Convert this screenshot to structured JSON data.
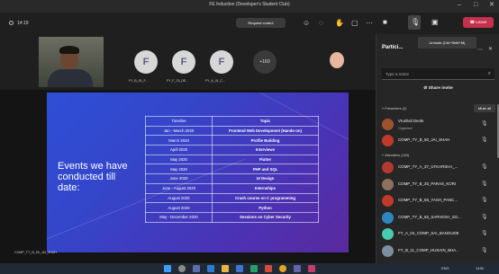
{
  "window": {
    "title": "FE Induction (Developer's Student Club)",
    "minimize": "–",
    "maximize": "□",
    "close": "✕"
  },
  "toolbar": {
    "timer": "14:19",
    "request_control": "Request control",
    "leave": "Leave"
  },
  "participants_strip": {
    "avatars": [
      {
        "initial": "F",
        "label": "FY_B_51_F...",
        "color": "#5c5c8a"
      },
      {
        "initial": "F",
        "label": "FY_F_23_DE...",
        "color": "#5c5c8a"
      },
      {
        "initial": "F",
        "label": "FY_A_41_C...",
        "color": "#5c5c8a"
      }
    ],
    "more_count": "+160"
  },
  "slide": {
    "heading": "Events we have conducted till date:",
    "table": {
      "headers": {
        "timeline": "Timeline",
        "topic": "Topic"
      },
      "rows": [
        {
          "timeline": "Jan - March 2020",
          "topic": "Frontend Web Development (Hands-on)"
        },
        {
          "timeline": "March 2020",
          "topic": "Profile Building"
        },
        {
          "timeline": "April 2020",
          "topic": "Interviews"
        },
        {
          "timeline": "May 2020",
          "topic": "Flutter"
        },
        {
          "timeline": "May 2020",
          "topic": "PHP and SQL"
        },
        {
          "timeline": "June 2020",
          "topic": "UI Design"
        },
        {
          "timeline": "June - August 2020",
          "topic": "Internships"
        },
        {
          "timeline": "August 2020",
          "topic": "Crash course on C programming"
        },
        {
          "timeline": "August 2020",
          "topic": "Python"
        },
        {
          "timeline": "May - December 2020",
          "topic": "Sessions on Cyber Security"
        }
      ]
    }
  },
  "presenter_tag": "COMP_TY_B_50_JAI_SHAH",
  "panel": {
    "title": "Partici...",
    "tooltip": "Unmute (Ctrl+Shift+M)",
    "search_placeholder": "Type a name",
    "share_invite": "Share invite",
    "presenters_header": "Presenters (2)",
    "mute_all": "Mute all",
    "attendees_header": "Attendees (163)",
    "presenters": [
      {
        "name": "Vrushali Deole",
        "sub": "Organizer",
        "color": "#a0522d"
      },
      {
        "name": "COMP_TY_B_50_JAI_SHAH",
        "sub": "",
        "color": "#c0392b"
      }
    ],
    "attendees": [
      {
        "name": "COMP_TY_A_37_UTKARSHA_...",
        "color": "#b03a2e"
      },
      {
        "name": "COMP_TY_B_25_PARAS_KORI",
        "color": "#8e7060"
      },
      {
        "name": "COMP_TY_B_55_YASH_PANC...",
        "color": "#c0392b"
      },
      {
        "name": "COMP_TY_B_65_SARVESH_SO...",
        "color": "#2e86c1"
      },
      {
        "name": "FY_A_04_COMP_SAI_BANGUDE",
        "color": "#48c9b0"
      },
      {
        "name": "FY_B_11_COMP_HUSAIN_BHA...",
        "color": "#7d8ea0"
      }
    ]
  },
  "taskbar": {
    "lang": "ENG",
    "time": "1430"
  }
}
